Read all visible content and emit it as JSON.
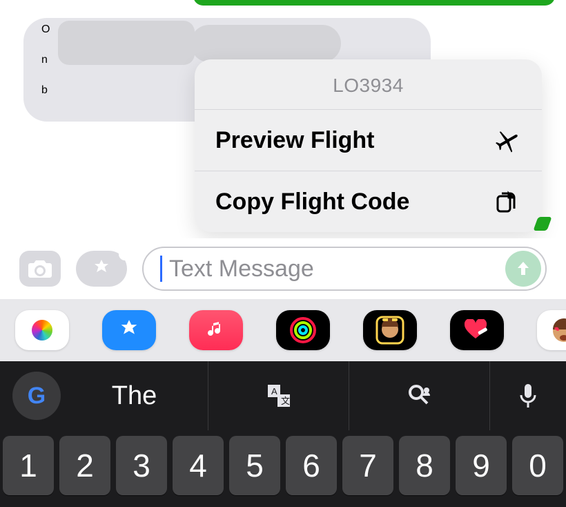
{
  "conversation": {
    "received_line1": "O",
    "received_line2": "n",
    "received_line3": "b"
  },
  "popover": {
    "title": "LO3934",
    "items": [
      {
        "label": "Preview Flight",
        "icon": "airplane-icon"
      },
      {
        "label": "Copy Flight Code",
        "icon": "documents-icon"
      }
    ]
  },
  "compose": {
    "placeholder": "Text Message"
  },
  "suggestions": {
    "word": "The"
  },
  "keys": {
    "n0": "1",
    "n1": "2",
    "n2": "3",
    "n3": "4",
    "n4": "5",
    "n5": "6",
    "n6": "7",
    "n7": "8",
    "n8": "9",
    "n9": "0"
  }
}
